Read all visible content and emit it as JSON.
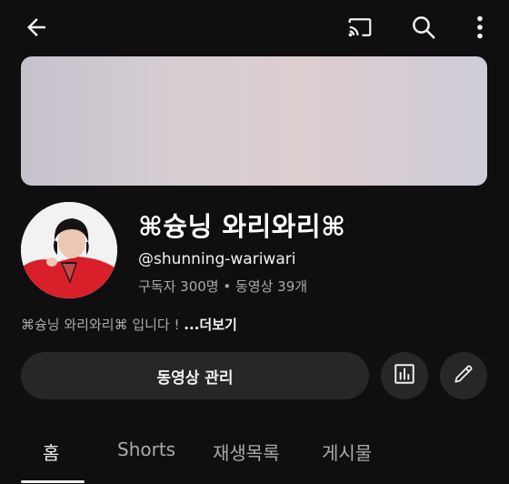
{
  "topbar": {
    "icons": [
      "back-arrow-icon",
      "cast-icon",
      "search-icon",
      "more-vert-icon"
    ]
  },
  "channel": {
    "name": "⌘슝닝 와리와리⌘",
    "handle": "@shunning-wariwari",
    "stats": "구독자 300명 • 동영상 39개",
    "description": "⌘슝닝 와리와리⌘ 입니다 ! ",
    "more_label": "...더보기"
  },
  "actions": {
    "manage_label": "동영상 관리",
    "analytics_icon": "analytics-icon",
    "edit_icon": "edit-pencil-icon"
  },
  "tabs": [
    {
      "label": "홈",
      "active": true
    },
    {
      "label": "Shorts",
      "active": false
    },
    {
      "label": "재생목록",
      "active": false
    },
    {
      "label": "게시물",
      "active": false
    }
  ],
  "colors": {
    "background": "#0f0f0f",
    "button_bg": "#272727",
    "text_primary": "#f1f1f1",
    "text_secondary": "#aaaaaa"
  }
}
